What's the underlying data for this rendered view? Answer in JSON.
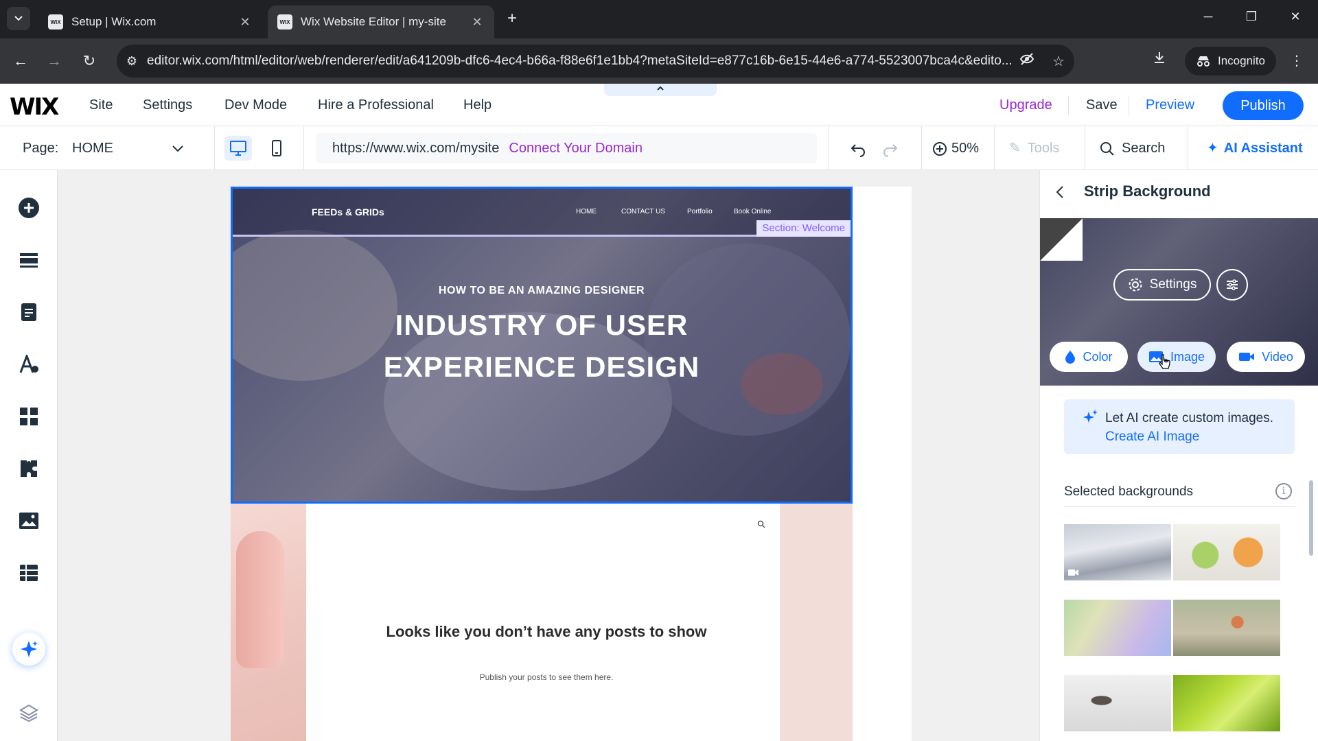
{
  "browser": {
    "tabs": [
      {
        "title": "Setup | Wix.com",
        "favicon": "WIX",
        "active": false
      },
      {
        "title": "Wix Website Editor | my-site",
        "favicon": "WIX",
        "active": true
      }
    ],
    "url": "editor.wix.com/html/editor/web/renderer/edit/a641209b-dfc6-4ec4-b66a-f88e6f1e1bb4?metaSiteId=e877c16b-6e15-44e6-a774-5523007bca4c&edito...",
    "profile_label": "Incognito"
  },
  "wix_top": {
    "logo": "WIX",
    "menu": [
      "Site",
      "Settings",
      "Dev Mode",
      "Hire a Professional",
      "Help"
    ],
    "upgrade": "Upgrade",
    "save": "Save",
    "preview": "Preview",
    "publish": "Publish"
  },
  "wix_toolbar": {
    "page_label": "Page:",
    "page_name": "HOME",
    "site_url": "https://www.wix.com/mysite",
    "connect_domain": "Connect Your Domain",
    "zoom": "50%",
    "tools": "Tools",
    "search": "Search",
    "ai_assistant": "AI Assistant"
  },
  "site": {
    "logo": "FEEDs & GRIDs",
    "nav": [
      "HOME",
      "CONTACT US",
      "Portfolio",
      "Book Online"
    ],
    "section_tag": "Section: Welcome",
    "hero_subtitle": "HOW TO BE AN AMAZING DESIGNER",
    "hero_title_line1": "INDUSTRY OF USER",
    "hero_title_line2": "EXPERIENCE DESIGN",
    "no_posts_title": "Looks like you don’t have any posts to show",
    "no_posts_sub": "Publish your posts to see them here."
  },
  "panel": {
    "title": "Strip Background",
    "settings_label": "Settings",
    "types": [
      {
        "label": "Color",
        "icon": "droplet-icon",
        "selected": false
      },
      {
        "label": "Image",
        "icon": "image-icon",
        "selected": true
      },
      {
        "label": "Video",
        "icon": "video-camera-icon",
        "selected": false
      }
    ],
    "ai_text": "Let AI create custom images.",
    "ai_link": "Create AI Image",
    "selected_heading": "Selected backgrounds",
    "thumbnails": [
      {
        "name": "snowy-mountains"
      },
      {
        "name": "citrus-fruits"
      },
      {
        "name": "pastel-gradient"
      },
      {
        "name": "floating-objects"
      },
      {
        "name": "person-lying"
      },
      {
        "name": "green-abstract"
      }
    ]
  },
  "colors": {
    "accent": "#116dff",
    "upgrade": "#9a27d5",
    "section_tag": "#7b61ff"
  }
}
